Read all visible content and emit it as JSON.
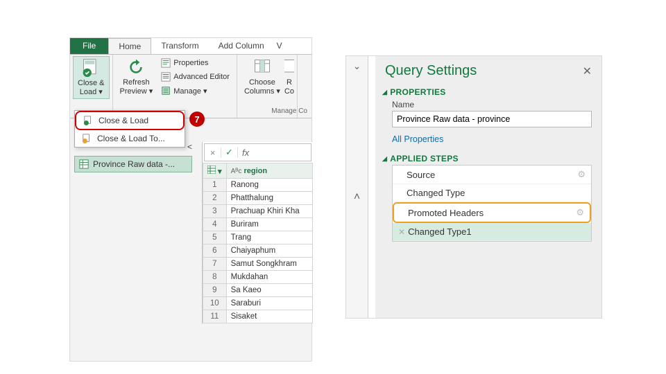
{
  "ribbon": {
    "tabs": {
      "file": "File",
      "home": "Home",
      "transform": "Transform",
      "add_column": "Add Column",
      "view_stub": "V"
    },
    "close_load": {
      "line1": "Close &",
      "line2": "Load ▾"
    },
    "refresh": {
      "line1": "Refresh",
      "line2": "Preview ▾"
    },
    "properties": "Properties",
    "adv_editor": "Advanced Editor",
    "manage": "Manage ▾",
    "choose_cols": {
      "line1": "Choose",
      "line2": "Columns ▾"
    },
    "remove_cols_stub": {
      "line1": "R",
      "line2": "Co"
    },
    "group_query": "Manage Co"
  },
  "dropdown": {
    "close_load": "Close & Load",
    "close_load_to": "Close & Load To..."
  },
  "callout7": "7",
  "nav": {
    "query_item": "Province Raw data -..."
  },
  "formula": {
    "fx": "fx"
  },
  "table": {
    "column_header": "region",
    "type_glyph": "Aᴮᴄ",
    "rows": [
      "Ranong",
      "Phatthalung",
      "Prachuap Khiri Kha",
      "Buriram",
      "Trang",
      "Chaiyaphum",
      "Samut Songkhram",
      "Mukdahan",
      "Sa Kaeo",
      "Saraburi",
      "Sisaket"
    ]
  },
  "query_settings": {
    "title": "Query Settings",
    "section_props": "PROPERTIES",
    "name_label": "Name",
    "name_value": "Province Raw data - province",
    "all_props": "All Properties",
    "section_steps": "APPLIED STEPS",
    "steps": {
      "s1": "Source",
      "s2": "Changed Type",
      "s3": "Promoted Headers",
      "s4": "Changed Type1"
    }
  }
}
